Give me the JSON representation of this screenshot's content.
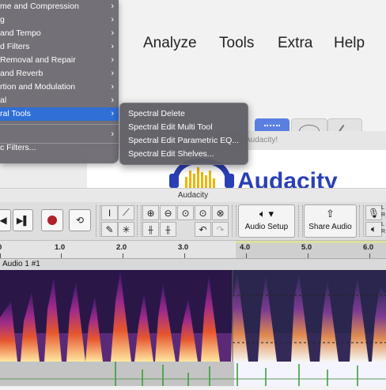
{
  "menubar": {
    "items": [
      "Analyze",
      "Tools",
      "Extra",
      "Help"
    ]
  },
  "main_menu": {
    "items": [
      {
        "label": "me and Compression"
      },
      {
        "label": "g"
      },
      {
        "label": "and Tempo"
      },
      {
        "label": "d Filters"
      },
      {
        "label": "Removal and Repair"
      },
      {
        "label": "and Reverb"
      },
      {
        "label": "rtion and Modulation"
      },
      {
        "label": "al"
      },
      {
        "label": "ral Tools"
      },
      {
        "label": ""
      },
      {
        "label": "c Filters..."
      }
    ]
  },
  "sub_menu": {
    "items": [
      "Spectral Delete",
      "Spectral Edit Multi Tool",
      "Spectral Edit Parametric EQ...",
      "Spectral Edit Shelves..."
    ]
  },
  "splash": {
    "title": "Audacity!",
    "logo_text": "Audacity"
  },
  "window": {
    "title": "Audacity"
  },
  "toolbar": {
    "audio_setup": "Audio Setup",
    "share_audio": "Share Audio",
    "meter_l": "L",
    "meter_r": "R"
  },
  "ruler": {
    "ticks": [
      "0",
      "1.0",
      "2.0",
      "3.0",
      "4.0",
      "5.0",
      "6.0"
    ]
  },
  "track": {
    "name": "Audio 1 #1"
  },
  "colors": {
    "menu_bg": "#69666e",
    "menu_highlight": "#2f6fd6",
    "splash_blue": "#2b3fb4",
    "wave_green": "#2f9b2f"
  }
}
